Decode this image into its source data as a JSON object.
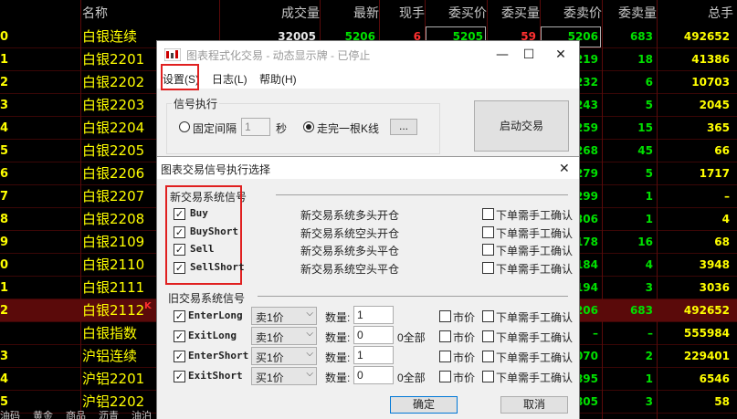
{
  "quote": {
    "columns": [
      "名称",
      "成交量",
      "最新",
      "现手",
      "委买价",
      "委买量",
      "委卖价",
      "委卖量",
      "总手"
    ],
    "rows": [
      {
        "code": "0",
        "name": "白银连续",
        "vol": "32005",
        "last": "5206",
        "hand": "6",
        "bid": "5205",
        "bidv": "59",
        "ask": "5206",
        "askv": "683",
        "total": "492652"
      },
      {
        "code": "1",
        "name": "白银2201",
        "ask": "219",
        "askv": "18",
        "total": "41386"
      },
      {
        "code": "2",
        "name": "白银2202",
        "ask": "232",
        "askv": "6",
        "total": "10703"
      },
      {
        "code": "3",
        "name": "白银2203",
        "ask": "243",
        "askv": "5",
        "total": "2045"
      },
      {
        "code": "4",
        "name": "白银2204",
        "ask": "259",
        "askv": "15",
        "total": "365"
      },
      {
        "code": "5",
        "name": "白银2205",
        "ask": "268",
        "askv": "45",
        "total": "66"
      },
      {
        "code": "6",
        "name": "白银2206",
        "ask": "279",
        "askv": "5",
        "total": "1717"
      },
      {
        "code": "7",
        "name": "白银2207",
        "ask": "299",
        "askv": "1",
        "total": "–"
      },
      {
        "code": "8",
        "name": "白银2208",
        "ask": "306",
        "askv": "1",
        "total": "4"
      },
      {
        "code": "9",
        "name": "白银2109",
        "ask": "178",
        "askv": "16",
        "total": "68"
      },
      {
        "code": "0",
        "name": "白银2110",
        "ask": "184",
        "askv": "4",
        "total": "3948"
      },
      {
        "code": "1",
        "name": "白银2111",
        "ask": "194",
        "askv": "3",
        "total": "3036"
      },
      {
        "code": "2",
        "name": "白银2112",
        "flag": "K",
        "ask": "206",
        "askv": "683",
        "total": "492652"
      },
      {
        "code": "",
        "name": "白银指数",
        "ask": "–",
        "askv": "–",
        "total": "555984"
      },
      {
        "code": "3",
        "name": "沪铝连续",
        "ask": "070",
        "askv": "2",
        "total": "229401"
      },
      {
        "code": "4",
        "name": "沪铝2201",
        "ask": "895",
        "askv": "1",
        "total": "6546"
      },
      {
        "code": "5",
        "name": "沪铝2202",
        "ask": "805",
        "askv": "3",
        "total": "58"
      }
    ],
    "bottom_tabs": [
      "油码",
      "黄金",
      "商品",
      "沥青",
      "油泊"
    ]
  },
  "main_dialog": {
    "title": "图表程式化交易 - 动态显示牌 - 已停止",
    "menu": [
      "设置(S)",
      "日志(L)",
      "帮助(H)"
    ],
    "signal_group": "信号执行",
    "fixed_interval": "固定间隔",
    "interval_value": "1",
    "seconds": "秒",
    "per_bar": "走完一根K线",
    "ellipsis": "...",
    "start_button": "启动交易"
  },
  "inner_dialog": {
    "title": "图表交易信号执行选择",
    "new_group": "新交易系统信号",
    "new_signals": [
      {
        "key": "Buy",
        "desc": "新交易系统多头开仓",
        "confirm": "下单需手工确认",
        "checked": true
      },
      {
        "key": "BuyShort",
        "desc": "新交易系统空头开仓",
        "confirm": "下单需手工确认",
        "checked": true
      },
      {
        "key": "Sell",
        "desc": "新交易系统多头平仓",
        "confirm": "下单需手工确认",
        "checked": true
      },
      {
        "key": "SellShort",
        "desc": "新交易系统空头平仓",
        "confirm": "下单需手工确认",
        "checked": true
      }
    ],
    "old_group": "旧交易系统信号",
    "old_signals": [
      {
        "key": "EnterLong",
        "price": "卖1价",
        "qty_label": "数量:",
        "qty": "1",
        "all": "",
        "market": "市价",
        "confirm": "下单需手工确认"
      },
      {
        "key": "ExitLong",
        "price": "卖1价",
        "qty_label": "数量:",
        "qty": "0",
        "all": "0全部",
        "market": "市价",
        "confirm": "下单需手工确认"
      },
      {
        "key": "EnterShort",
        "price": "买1价",
        "qty_label": "数量:",
        "qty": "1",
        "all": "",
        "market": "市价",
        "confirm": "下单需手工确认"
      },
      {
        "key": "ExitShort",
        "price": "买1价",
        "qty_label": "数量:",
        "qty": "0",
        "all": "0全部",
        "market": "市价",
        "confirm": "下单需手工确认"
      }
    ],
    "ok": "确定",
    "cancel": "取消"
  },
  "colors": {
    "highlight_red": "#e02020",
    "quote_yellow": "#ffff00",
    "quote_green": "#00e000",
    "quote_red": "#ff3030"
  }
}
